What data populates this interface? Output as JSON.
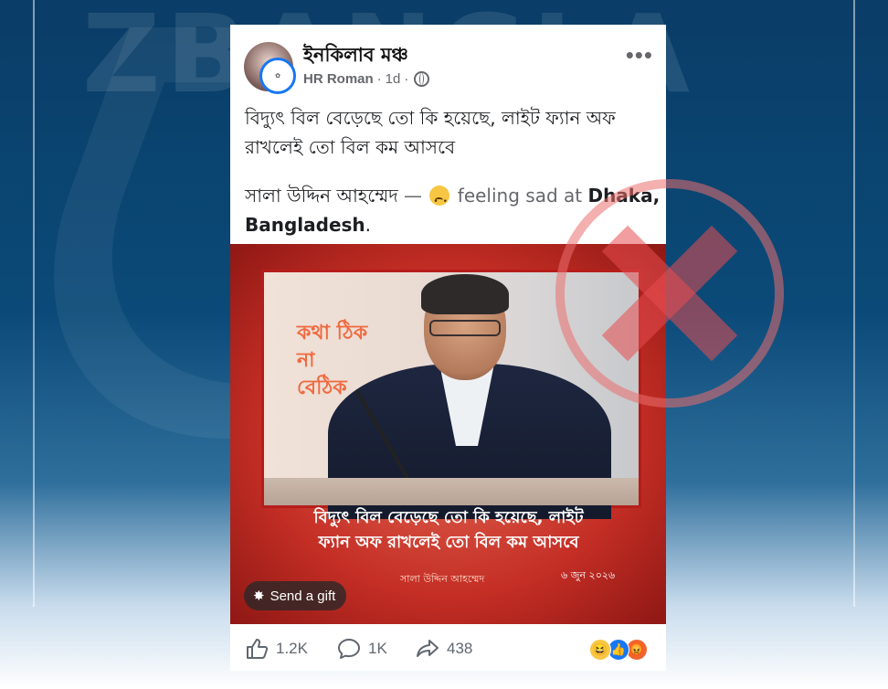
{
  "background": {
    "logo_text": "ZBANGLA"
  },
  "post": {
    "page_name": "ইনকিলাব মঞ্চ",
    "author": "HR Roman",
    "time": "1d",
    "separator": "·",
    "more": "•••",
    "text_line1": "বিদ্যুৎ বিল বেড়েছে তো কি হয়েছে, লাইট ফ্যান অফ",
    "text_line2": "রাখলেই তো বিল কম আসবে",
    "tag_person": "সালা উদ্দিন আহম্মেদ",
    "tag_dash": " — ",
    "feeling": "feeling sad at",
    "location_1": "Dhaka,",
    "location_2": "Bangladesh",
    "location_end": "."
  },
  "image": {
    "caption_words": [
      "কথা ঠিক",
      "না",
      "বেঠিক"
    ],
    "banner_line1": "বিদ্যুৎ বিল বেড়েছে তো কি হয়েছে, লাইট",
    "banner_line2": "ফ্যান অফ রাখলেই তো বিল কম আসবে",
    "speaker": "সালা উদ্দিন আহম্মেদ",
    "date": "৬ জুন ২০২৬"
  },
  "gift_button": "Send a gift",
  "actions": {
    "likes": "1.2K",
    "comments": "1K",
    "shares": "438"
  },
  "colors": {
    "facebook_blue": "#1877f2",
    "image_red": "#c42e25",
    "x_mark": "#e74c50"
  }
}
